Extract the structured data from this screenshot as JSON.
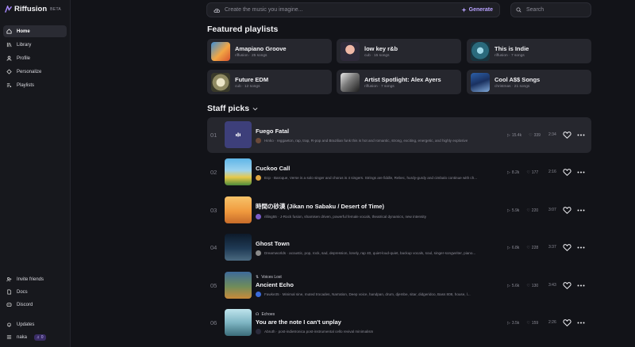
{
  "brand": {
    "name": "Riffusion",
    "badge": "BETA"
  },
  "sidebar": {
    "nav": [
      {
        "label": "Home",
        "icon": "home-icon",
        "active": true
      },
      {
        "label": "Library",
        "icon": "library-icon"
      },
      {
        "label": "Profile",
        "icon": "profile-icon"
      },
      {
        "label": "Personalize",
        "icon": "personalize-icon"
      },
      {
        "label": "Playlists",
        "icon": "playlists-icon"
      }
    ],
    "footer": [
      {
        "label": "Invite friends",
        "icon": "invite-icon"
      },
      {
        "label": "Docs",
        "icon": "docs-icon"
      },
      {
        "label": "Discord",
        "icon": "discord-icon"
      },
      {
        "label": "Updates",
        "icon": "bell-icon"
      }
    ],
    "user": {
      "name": "naka",
      "credits": "0"
    }
  },
  "prompt": {
    "placeholder": "Create the music you imagine...",
    "generate_label": "Generate"
  },
  "search": {
    "placeholder": "Search"
  },
  "featured": {
    "heading": "Featured playlists",
    "items": [
      {
        "title": "Amapiano Groove",
        "sub": "riffusion · 25 songs"
      },
      {
        "title": "low key r&b",
        "sub": "cub · 15 songs"
      },
      {
        "title": "This is Indie",
        "sub": "riffusion · 7 songs"
      },
      {
        "title": "Future EDM",
        "sub": "cub · 12 songs"
      },
      {
        "title": "Artist Spotlight: Alex Ayers",
        "sub": "riffusion · 7 songs"
      },
      {
        "title": "Cool A$$ Songs",
        "sub": "christmas · 21 songs"
      }
    ]
  },
  "staff": {
    "heading": "Staff picks",
    "rows": [
      {
        "num": "01",
        "tag": "",
        "title": "Fuego Fatal",
        "desc": "Hinko · reggaeton, rap, trap, R-pop and Brazilian funk this is hot and romantic, strong, exciting, energetic, and highly explosive",
        "plays": "15.4k",
        "likes": "339",
        "dur": "2:34"
      },
      {
        "num": "02",
        "tag": "",
        "title": "Cuckoo Call",
        "desc": "Ecp · Baroque, Verse is a solo singer and chorus is 4 singers. Strings are fiddle, Rebec, hurdy-gurdy and cimbalo continue with ch...",
        "plays": "8.2k",
        "likes": "177",
        "dur": "2:16"
      },
      {
        "num": "03",
        "tag": "",
        "title": "時間の砂漠 (Jikan no Sabaku / Desert of Time)",
        "desc": "rilling55 · J-Rock fusion, shamisen driven, powerful female vocals, theatrical dynamics, new intensity",
        "plays": "5.9k",
        "likes": "220",
        "dur": "3:07"
      },
      {
        "num": "04",
        "tag": "",
        "title": "Ghost Town",
        "desc": "Dreamworlds · acoustic, pop, rock, sad, depression, lonely, rap 40, quiet-loud-quiet, backup vocals, soul, singer-songwriter, piano...",
        "plays": "6.8k",
        "likes": "228",
        "dur": "3:37"
      },
      {
        "num": "05",
        "tag": "Voices Lost",
        "title": "Ancient Echo",
        "desc": "Fawke35 · Minimal sine, muted trocades, Narration, Deep voice, handpan, drum, djembe, sitar, didgeridoo, Bass 808, house, l...",
        "plays": "5.6k",
        "likes": "130",
        "dur": "3:43"
      },
      {
        "num": "06",
        "tag": "Echoes",
        "title": "You are the note I can't unplay",
        "desc": "Abruth · post-indietronica post-instrumental cello revival minimalism",
        "plays": "3.5k",
        "likes": "159",
        "dur": "2:26"
      }
    ]
  }
}
